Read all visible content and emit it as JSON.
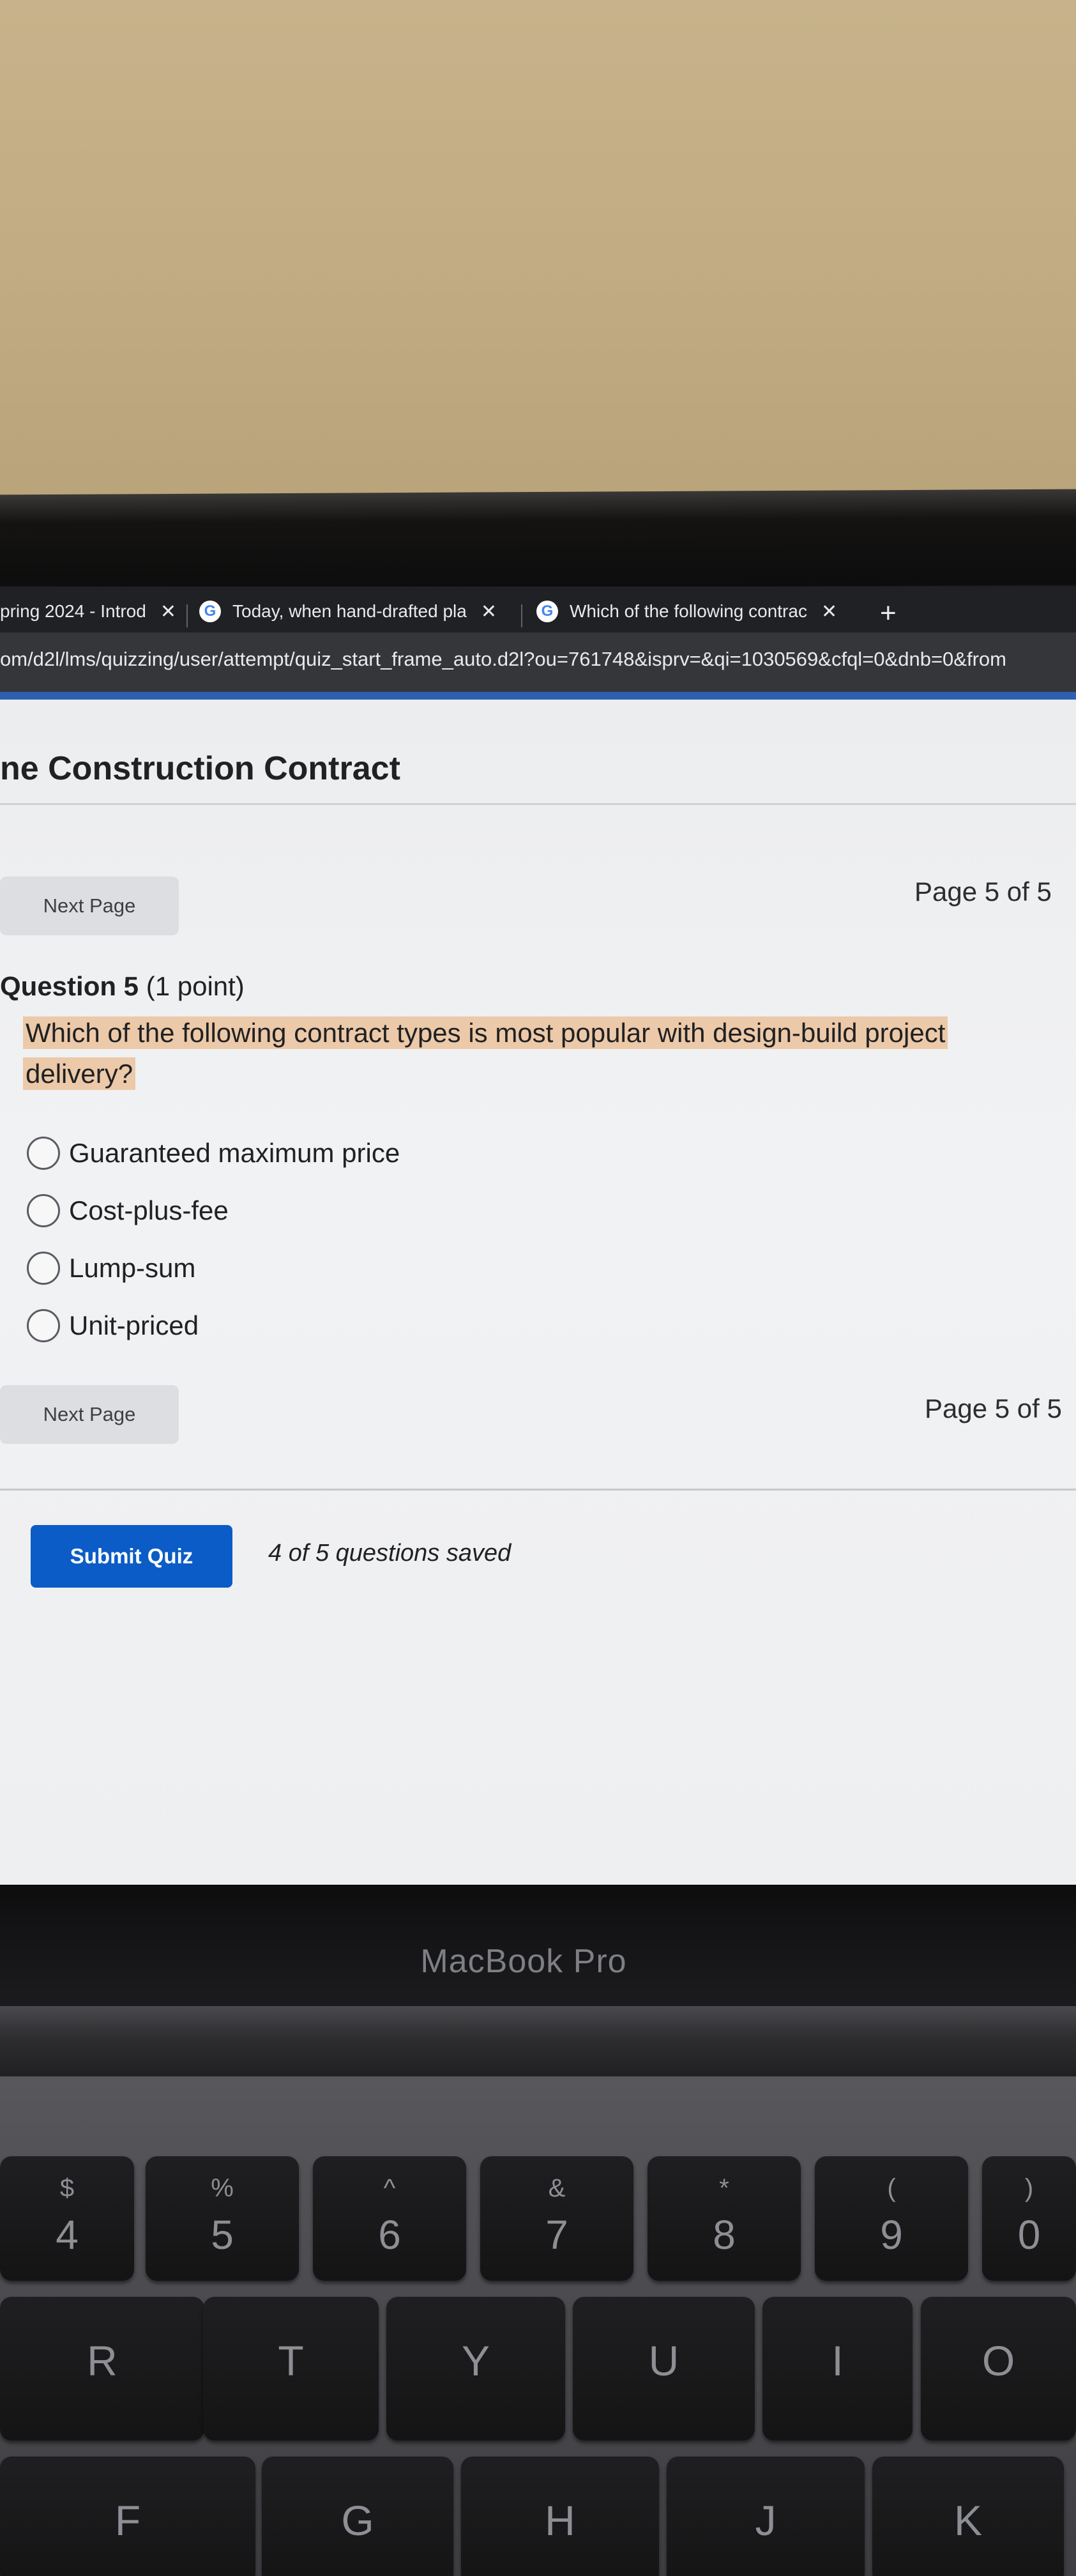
{
  "browser": {
    "tabs": [
      {
        "label": "pring 2024 - Introd",
        "close": "✕"
      },
      {
        "label": "Today, when hand-drafted pla",
        "close": "✕",
        "icon": "google-g-icon"
      },
      {
        "label": "Which of the following contrac",
        "close": "✕",
        "icon": "google-g-icon"
      }
    ],
    "new_tab": "+",
    "url": "om/d2l/lms/quizzing/user/attempt/quiz_start_frame_auto.d2l?ou=761748&isprv=&qi=1030569&cfql=0&dnb=0&from"
  },
  "quiz": {
    "title": "ne Construction Contract",
    "next_page_label": "Next Page",
    "page_indicator": "Page 5 of 5",
    "question_label": "Question 5",
    "question_points": "(1 point)",
    "question_text": "Which of the following contract types is most popular with design-build project delivery?",
    "options": [
      "Guaranteed maximum price",
      "Cost-plus-fee",
      "Lump-sum",
      "Unit-priced"
    ],
    "submit_label": "Submit Quiz",
    "saved_status": "4 of 5 questions saved"
  },
  "device": {
    "label": "MacBook Pro"
  },
  "keyboard": {
    "number_row": [
      {
        "top": "$",
        "bottom": "4"
      },
      {
        "top": "%",
        "bottom": "5"
      },
      {
        "top": "^",
        "bottom": "6"
      },
      {
        "top": "&",
        "bottom": "7"
      },
      {
        "top": "*",
        "bottom": "8"
      },
      {
        "top": "(",
        "bottom": "9"
      },
      {
        "top": ")",
        "bottom": "0"
      }
    ],
    "letter_row_1": [
      "R",
      "T",
      "Y",
      "U",
      "I",
      "O"
    ],
    "letter_row_2": [
      "F",
      "G",
      "H",
      "J",
      "K"
    ]
  },
  "colors": {
    "highlight": "#ecc9a9",
    "submit_button": "#0b5cc7",
    "tab_bar": "#202124"
  }
}
